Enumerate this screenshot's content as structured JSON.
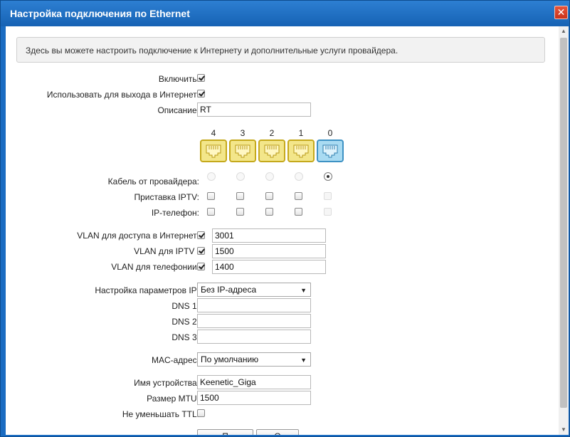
{
  "window": {
    "title": "Настройка подключения по Ethernet",
    "close_label": "✕"
  },
  "info": "Здесь вы можете настроить подключение к Интернету и дополнительные услуги провайдера.",
  "general": {
    "enable_label": "Включить:",
    "use_for_internet_label": "Использовать для выхода в Интернет:",
    "description_label": "Описание:",
    "description_value": "RT"
  },
  "ports": {
    "numbers": [
      "4",
      "3",
      "2",
      "1",
      "0"
    ],
    "provider_cable_label": "Кабель от провайдера:",
    "iptv_label": "Приставка IPTV:",
    "ip_phone_label": "IP-телефон:"
  },
  "vlan": {
    "internet_label": "VLAN для доступа в Интернет:",
    "internet_value": "3001",
    "iptv_label": "VLAN для IPTV :",
    "iptv_value": "1500",
    "phone_label": "VLAN для телефонии:",
    "phone_value": "1400"
  },
  "ip": {
    "settings_label": "Настройка параметров IP:",
    "settings_value": "Без IP-адреса",
    "dns1_label": "DNS 1:",
    "dns2_label": "DNS 2:",
    "dns3_label": "DNS 3:"
  },
  "mac": {
    "label": "MAC-адрес:",
    "value": "По умолчанию"
  },
  "device": {
    "name_label": "Имя устройства:",
    "name_value": "Keenetic_Giga",
    "mtu_label": "Размер MTU:",
    "mtu_value": "1500",
    "ttl_label": "Не уменьшать TTL:"
  },
  "buttons": {
    "apply_label": "П",
    "cancel_label": "О"
  },
  "icons": {
    "port": "ethernet-port-icon",
    "dropdown": "chevron-down-icon",
    "close": "close-icon"
  },
  "colors": {
    "titlebar": "#1a6cc2",
    "port_yellow": "#f3e68a",
    "port_blue": "#a9dbf2",
    "close": "#d6402a"
  }
}
